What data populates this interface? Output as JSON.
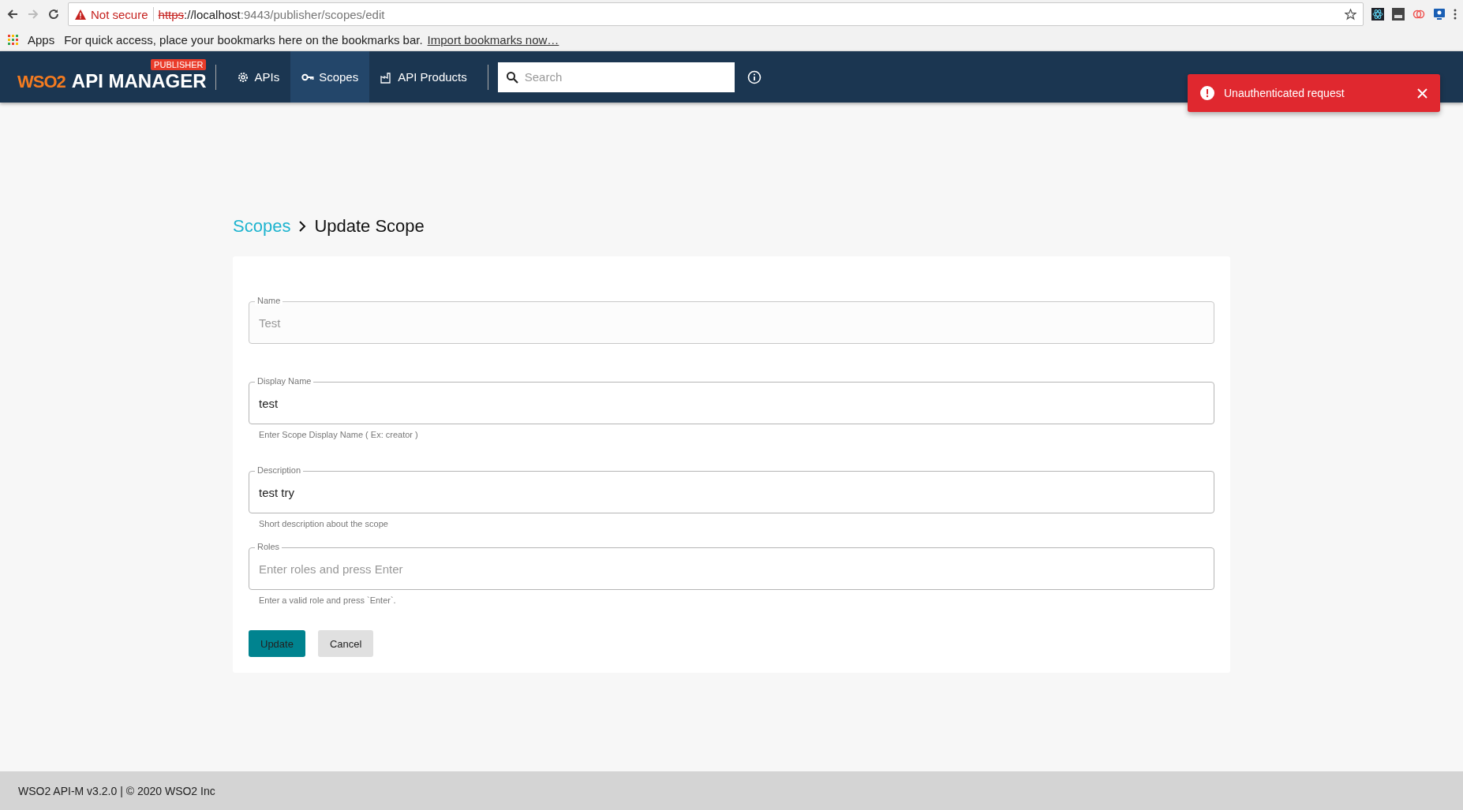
{
  "browser": {
    "security_warning": "Not secure",
    "url_scheme": "https",
    "url_rest": "://localhost",
    "url_path": ":9443/publisher/scopes/edit"
  },
  "bookmarks_bar": {
    "apps": "Apps",
    "message": "For quick access, place your bookmarks here on the bookmarks bar.",
    "import_link": "Import bookmarks now…"
  },
  "header": {
    "logo": "WSO2",
    "product": "API MANAGER",
    "badge": "PUBLISHER",
    "nav": [
      {
        "label": "APIs",
        "selected": false
      },
      {
        "label": "Scopes",
        "selected": true
      },
      {
        "label": "API Products",
        "selected": false
      }
    ],
    "search": {
      "placeholder": "Search"
    }
  },
  "toast": {
    "message": "Unauthenticated request"
  },
  "breadcrumb": {
    "parent": "Scopes",
    "current": "Update Scope"
  },
  "form": {
    "fields": [
      {
        "label": "Name",
        "value": "Test",
        "disabled": true
      },
      {
        "label": "Display Name",
        "value": "test",
        "disabled": false,
        "helper": "Enter Scope Display Name ( Ex: creator )"
      },
      {
        "label": "Description",
        "value": "test try",
        "disabled": false,
        "helper": "Short description about the scope"
      },
      {
        "label": "Roles",
        "placeholder": "Enter roles and press Enter",
        "disabled": false,
        "helper": "Enter a valid role and press `Enter`."
      }
    ],
    "buttons": [
      {
        "label": "Update",
        "kind": "primary"
      },
      {
        "label": "Cancel",
        "kind": "secondary"
      }
    ]
  },
  "footer": "WSO2 API-M v3.2.0 | © 2020 WSO2 Inc"
}
